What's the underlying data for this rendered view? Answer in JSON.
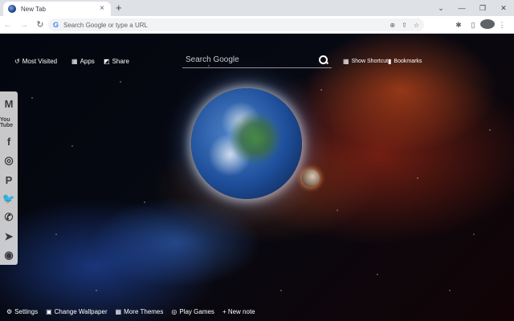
{
  "tab": {
    "title": "New Tab",
    "close_glyph": "×"
  },
  "new_tab_glyph": "+",
  "window_controls": [
    "⌄",
    "—",
    "❐",
    "✕"
  ],
  "nav": {
    "back": "←",
    "forward": "→",
    "reload": "↻"
  },
  "omnibox": {
    "placeholder": "Search Google or type a URL",
    "g_glyph": "G"
  },
  "toolbar_icons": [
    "⊕",
    "⇪",
    "☆"
  ],
  "toolbar_right": [
    "✱",
    "▯",
    "⋮"
  ],
  "topnav": {
    "most_visited": "Most Visited",
    "apps": "Apps",
    "share": "Share",
    "show_shortcuts": "Show Shortcuts",
    "bookmarks": "Bookmarks"
  },
  "search": {
    "placeholder": "Search Google"
  },
  "social": {
    "gmail": "M",
    "youtube": "You Tube",
    "facebook": "f",
    "instagram": "◎",
    "pinterest": "P",
    "twitter": "🐦",
    "whatsapp": "✆",
    "telegram": "➤",
    "reddit": "◉"
  },
  "bottom": {
    "settings": "Settings",
    "change_wallpaper": "Change Wallpaper",
    "more_themes": "More Themes",
    "play_games": "Play Games",
    "new_note": "+ New note"
  },
  "colors": {
    "accent": "#4285f4",
    "chrome_bg": "#dee1e6",
    "text_light": "#ffffff"
  }
}
